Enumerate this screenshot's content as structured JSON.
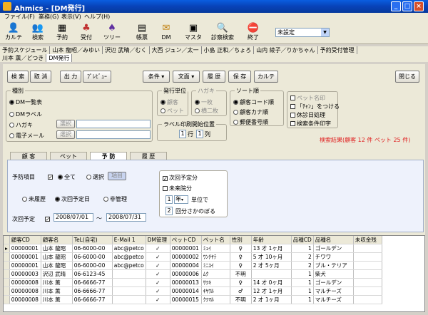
{
  "window": {
    "title": "Ahmics - [DM発行]",
    "min": "_",
    "max": "□",
    "close": "×"
  },
  "menu": [
    "ファイル(F)",
    "業務(G)",
    "表示(V)",
    "ヘルプ(H)"
  ],
  "toolbar": [
    {
      "label": "カルテ",
      "icon": "person-icon"
    },
    {
      "label": "検索",
      "icon": "search-people-icon"
    },
    {
      "label": "予約",
      "icon": "calendar-icon"
    },
    {
      "label": "受付",
      "icon": "reception-icon"
    },
    {
      "label": "ツリー",
      "icon": "tree-icon"
    },
    {
      "label": "帳票",
      "icon": "report-icon"
    },
    {
      "label": "DM",
      "icon": "mail-icon"
    },
    {
      "label": "マスタ",
      "icon": "master-icon"
    },
    {
      "label": "診察検索",
      "icon": "magnifier-icon"
    },
    {
      "label": "終了",
      "icon": "exit-icon"
    }
  ],
  "setting_select": "未設定",
  "open_tabs_row1": [
    "予約スケジュール",
    "山本 龍昭／みゆい",
    "沢辺 武晴／むく",
    "大西 ジュン／太一",
    "小島 正和／ちょろ",
    "山内 綾子／りかちゃん",
    "予約受付管理"
  ],
  "open_tabs_row2": [
    "川本 薫／どつき",
    "DM発行"
  ],
  "buttons": {
    "search": "検 索",
    "cancel": "取 消",
    "output": "出 力",
    "preview": "ﾌﾟﾚﾋﾞｭｰ",
    "condition": "条件",
    "text": "文面",
    "history": "履 歴",
    "save": "保 存",
    "karte": "カルテ",
    "close": "閉じる"
  },
  "type_group": {
    "title": "種別",
    "opt_dm": "DM一覧表",
    "opt_label": "DMラベル",
    "opt_postcard": "ハガキ",
    "opt_email": "電子メール",
    "select1": "選択",
    "select2": "選択"
  },
  "issue_unit": {
    "title": "発行単位",
    "client": "顧客",
    "pet": "ペット"
  },
  "postcard": {
    "title": "ハガキ",
    "single": "一枚",
    "double": "横二枚"
  },
  "sort": {
    "title": "ソート順",
    "code": "顧客コード順",
    "kana": "顧客カナ順",
    "zip": "郵便番号順"
  },
  "options": {
    "pet_name": "ペット名印",
    "chan": "「ﾁｬﾝ」をつける",
    "holiday": "休診日処理",
    "print_cond": "検索条件印字"
  },
  "label_pos": {
    "title": "ラベル印刷開始位置",
    "row": "1",
    "row_lbl": "行",
    "col": "1",
    "col_lbl": "列"
  },
  "result": "検索結果(顧客 12 件  ペット 25 件)",
  "tabs": [
    "顧 客",
    "ペット",
    "予 防",
    "履 歴"
  ],
  "prevention": {
    "item_lbl": "予防項目",
    "all": "全て",
    "choose": "選択",
    "item_btn": "項目",
    "unperformed": "未履歴",
    "next_date": "次回予定日",
    "unmanaged": "非管理",
    "next_lbl": "次回予定",
    "date_from": "2008/07/01",
    "tilde": "〜",
    "date_to": "2008/07/31",
    "next_part": "次回予定分",
    "unperformed_part": "未来院分",
    "year_val": "1",
    "year_unit": "年",
    "unit_suffix": "単位で",
    "count_val": "2",
    "count_suffix": "回分さかのぼる"
  },
  "grid": {
    "headers": [
      "顧客CD",
      "顧客名",
      "TeL(自宅)",
      "E-Mail 1",
      "DM管理",
      "ペットCD",
      "ペット名",
      "性別",
      "年齢",
      "品種CD",
      "品種名",
      "未収金残"
    ],
    "rows": [
      [
        "00000001",
        "山本 龍昭",
        "06-6000-00",
        "abc@petco",
        "✓",
        "00000001",
        "ﾐｭｲ",
        "♀",
        "13 才 1ヶ月",
        "1",
        "ゴールデン",
        ""
      ],
      [
        "00000001",
        "山本 龍昭",
        "06-6000-00",
        "abc@petco",
        "✓",
        "00000002",
        "ﾜﾝﾁﾔﾃ",
        "♀",
        "5 才 10ヶ月",
        "2",
        "チワワ",
        ""
      ],
      [
        "00000001",
        "山本 龍昭",
        "06-6000-00",
        "abc@petco",
        "✓",
        "00000004",
        "ﾐﾆﾕｲ",
        "♀",
        "2 才 5ヶ月",
        "2",
        "ブル・テリア",
        ""
      ],
      [
        "00000003",
        "沢辺 武晴",
        "06-6123-45",
        "",
        "✓",
        "00000006",
        "ﾑｸ",
        "不明",
        "",
        "1",
        "柴犬",
        ""
      ],
      [
        "00000008",
        "川本 薫",
        "06-6666-77",
        "",
        "✓",
        "00000013",
        "ｻﾂｷ",
        "♀",
        "14 才 0ヶ月",
        "1",
        "ゴールデン",
        ""
      ],
      [
        "00000008",
        "川本 薫",
        "06-6666-77",
        "",
        "✓",
        "00000014",
        "ｷﾔﾜﾙ",
        "♂",
        "12 才 1ヶ月",
        "1",
        "マルチーズ",
        ""
      ],
      [
        "00000008",
        "川本 薫",
        "06-6666-77",
        "",
        "✓",
        "00000015",
        "ｸﾂﾏﾙ",
        "不明",
        "2 才 1ヶ月",
        "1",
        "マルチーズ",
        ""
      ]
    ]
  }
}
